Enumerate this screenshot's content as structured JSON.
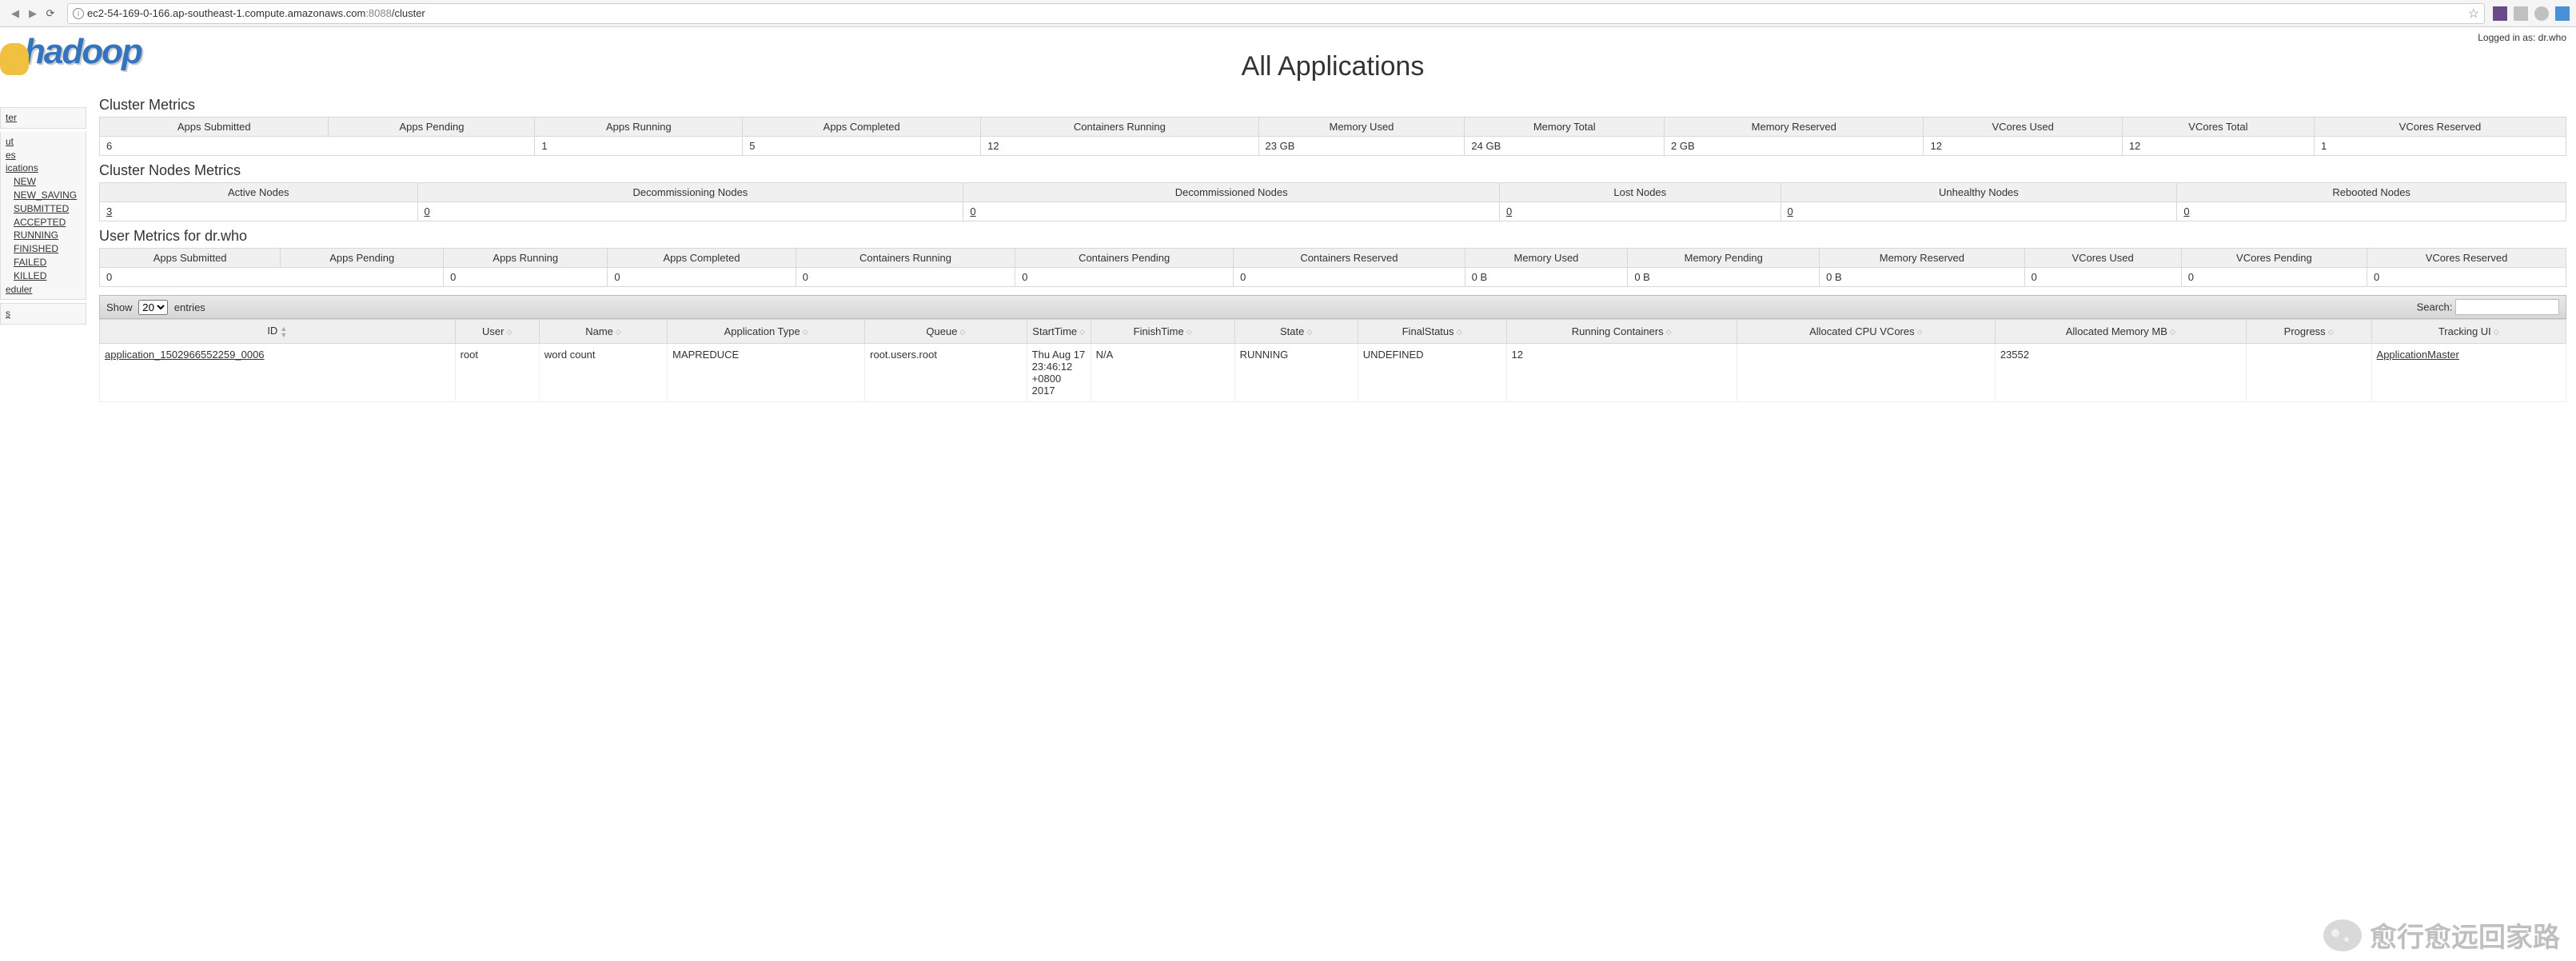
{
  "browser": {
    "url_host": "ec2-54-169-0-166.ap-southeast-1.compute.amazonaws.com",
    "url_port": ":8088",
    "url_path": "/cluster"
  },
  "login_text": "Logged in as: dr.who",
  "logo_text": "hadoop",
  "page_title": "All Applications",
  "sidebar": {
    "cluster": "ter",
    "about": "ut",
    "nodes": "es",
    "applications": "ications",
    "states": [
      "NEW",
      "NEW_SAVING",
      "SUBMITTED",
      "ACCEPTED",
      "RUNNING",
      "FINISHED",
      "FAILED",
      "KILLED"
    ],
    "scheduler": "eduler",
    "tools": "s"
  },
  "sections": {
    "cluster_metrics": "Cluster Metrics",
    "cluster_nodes": "Cluster Nodes Metrics",
    "user_metrics": "User Metrics for dr.who"
  },
  "cluster_metrics": {
    "headers": [
      "Apps Submitted",
      "Apps Pending",
      "Apps Running",
      "Apps Completed",
      "Containers Running",
      "Memory Used",
      "Memory Total",
      "Memory Reserved",
      "VCores Used",
      "VCores Total",
      "VCores Reserved"
    ],
    "values": [
      "6",
      "1",
      "5",
      "12",
      "23 GB",
      "24 GB",
      "2 GB",
      "12",
      "12",
      "1"
    ],
    "apps_submitted": "6"
  },
  "nodes_metrics": {
    "headers": [
      "Active Nodes",
      "Decommissioning Nodes",
      "Decommissioned Nodes",
      "Lost Nodes",
      "Unhealthy Nodes",
      "Rebooted Nodes"
    ],
    "values": [
      "3",
      "0",
      "0",
      "0",
      "0",
      "0"
    ]
  },
  "user_metrics": {
    "headers": [
      "Apps Submitted",
      "Apps Pending",
      "Apps Running",
      "Apps Completed",
      "Containers Running",
      "Containers Pending",
      "Containers Reserved",
      "Memory Used",
      "Memory Pending",
      "Memory Reserved",
      "VCores Used",
      "VCores Pending",
      "VCores Reserved"
    ],
    "values": [
      "0",
      "0",
      "0",
      "0",
      "0",
      "0",
      "0 B",
      "0 B",
      "0 B",
      "0",
      "0",
      "0"
    ],
    "first": "0"
  },
  "datatable": {
    "show": "Show",
    "entries": "entries",
    "entries_value": "20",
    "search": "Search:"
  },
  "apps_table": {
    "headers": [
      "ID",
      "User",
      "Name",
      "Application Type",
      "Queue",
      "StartTime",
      "FinishTime",
      "State",
      "FinalStatus",
      "Running Containers",
      "Allocated CPU VCores",
      "Allocated Memory MB",
      "Progress",
      "Tracking UI"
    ],
    "row": {
      "id": "application_1502966552259_0006",
      "user": "root",
      "name": "word count",
      "type": "MAPREDUCE",
      "queue": "root.users.root",
      "start": "Thu Aug 17 23:46:12 +0800 2017",
      "finish": "N/A",
      "state": "RUNNING",
      "final": "UNDEFINED",
      "running_containers": "12",
      "cpu": "",
      "mem": "23552",
      "progress": "",
      "tracking": "ApplicationMaster"
    }
  },
  "watermark": "愈行愈远回家路"
}
